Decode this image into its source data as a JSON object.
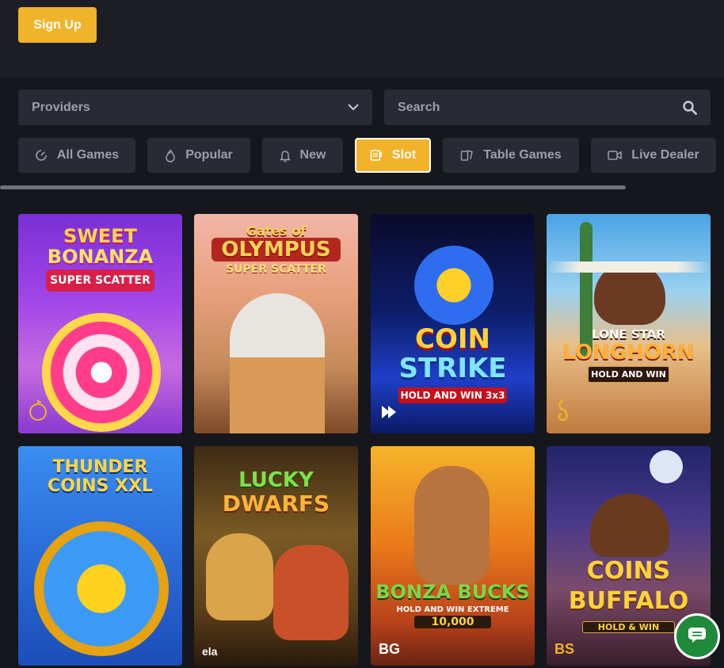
{
  "header": {
    "signup_label": "Sign Up"
  },
  "filters": {
    "providers_label": "Providers",
    "search_placeholder": "Search"
  },
  "tabs": [
    {
      "label": "All Games",
      "icon": "all-games-icon",
      "active": false
    },
    {
      "label": "Popular",
      "icon": "flame-icon",
      "active": false
    },
    {
      "label": "New",
      "icon": "bell-icon",
      "active": false
    },
    {
      "label": "Slot",
      "icon": "slot-machine-icon",
      "active": true
    },
    {
      "label": "Table Games",
      "icon": "cards-icon",
      "active": false
    },
    {
      "label": "Live Dealer",
      "icon": "video-camera-icon",
      "active": false
    }
  ],
  "games": [
    {
      "line1": "SWEET",
      "line2": "BONANZA",
      "line3": "SUPER SCATTER",
      "provider": "",
      "provider_icon": "bomb-icon"
    },
    {
      "line1": "Gates of",
      "line2": "OLYMPUS",
      "line3": "SUPER SCATTER",
      "provider": ""
    },
    {
      "line1": "COIN",
      "line2": "STRIKE",
      "line3": "HOLD AND WIN 3x3",
      "provider": ""
    },
    {
      "line1": "LONE STAR",
      "line2": "LONGHORN",
      "line3": "HOLD AND WIN",
      "provider": ""
    },
    {
      "line1": "THUNDER",
      "line2": "COINS XXL",
      "line3": "",
      "provider": ""
    },
    {
      "line1": "LUCKY",
      "line2": "DWARFS",
      "line3": "",
      "provider": "ela"
    },
    {
      "line1": "BONZA BUCKS",
      "line2": "HOLD AND WIN EXTREME",
      "line3": "10,000",
      "provider": "BG"
    },
    {
      "line1": "COINS",
      "line2": "BUFFALO",
      "line3": "HOLD & WIN",
      "provider": "BS"
    }
  ],
  "colors": {
    "accent": "#f0b32a",
    "background": "#16171c",
    "panel": "#292a33",
    "chat": "#1f8a3c"
  }
}
